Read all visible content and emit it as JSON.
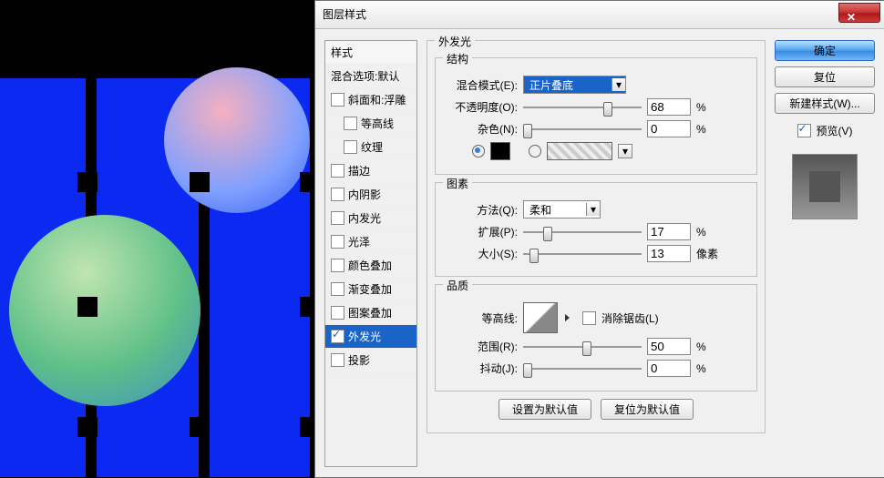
{
  "dlg": {
    "title": "图层样式",
    "ok": "确定",
    "cancel": "复位",
    "newstyle": "新建样式(W)...",
    "preview_label": "预览(V)"
  },
  "styles": {
    "header1": "样式",
    "header2": "混合选项:默认",
    "bevel": "斜面和:浮雕",
    "contour": "等高线",
    "texture": "纹理",
    "stroke": "描边",
    "innershadow": "内阴影",
    "innerglow": "内发光",
    "satin": "光泽",
    "coloroverlay": "颜色叠加",
    "gradoverlay": "渐变叠加",
    "patoverlay": "图案叠加",
    "outerglow": "外发光",
    "dropshadow": "投影"
  },
  "panel": {
    "outerglow": "外发光",
    "structure": "结构",
    "blend_label": "混合模式(E):",
    "blend_value": "正片叠底",
    "opacity_label": "不透明度(O):",
    "opacity_value": "68",
    "noise_label": "杂色(N):",
    "noise_value": "0",
    "elements": "图素",
    "method_label": "方法(Q):",
    "method_value": "柔和",
    "spread_label": "扩展(P):",
    "spread_value": "17",
    "size_label": "大小(S):",
    "size_value": "13",
    "size_unit": "像素",
    "quality": "品质",
    "contour_label": "等高线:",
    "anti_label": "消除锯齿(L)",
    "range_label": "范围(R):",
    "range_value": "50",
    "jitter_label": "抖动(J):",
    "jitter_value": "0",
    "percent": "%",
    "setdefault": "设置为默认值",
    "resetdefault": "复位为默认值"
  }
}
